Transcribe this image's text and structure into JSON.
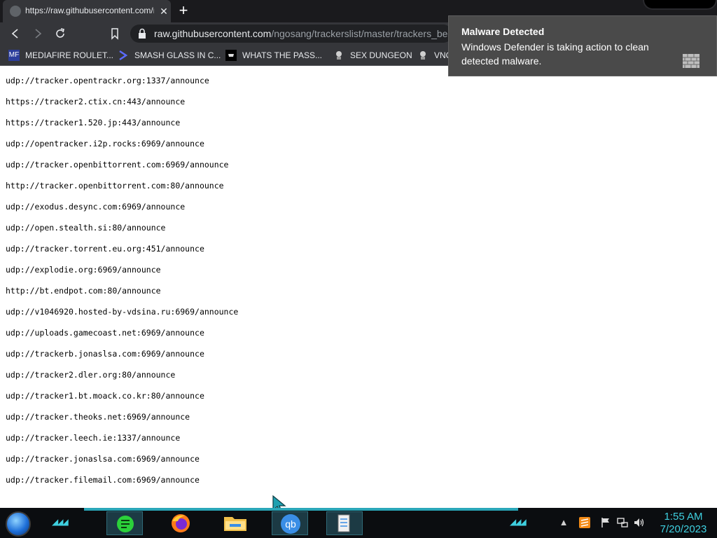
{
  "browser": {
    "tab": {
      "title": "https://raw.githubusercontent.com/ngosang/trackerslist/master/trackers_best.txt",
      "close_glyph": "✕"
    },
    "new_tab_glyph": "+",
    "url_host": "raw.githubusercontent.com",
    "url_path": "/ngosang/trackerslist/master/trackers_best.txt"
  },
  "bookmarks": [
    {
      "label": "MEDIAFIRE ROULET...",
      "icon": "MF"
    },
    {
      "label": "SMASH GLASS IN C...",
      "icon": "chevron"
    },
    {
      "label": "WHATS THE PASS...",
      "icon": "mask"
    },
    {
      "label": "SEX DUNGEON",
      "icon": "game"
    },
    {
      "label": "VNC",
      "icon": "game"
    }
  ],
  "trackers": [
    "udp://tracker.opentrackr.org:1337/announce",
    "https://tracker2.ctix.cn:443/announce",
    "https://tracker1.520.jp:443/announce",
    "udp://opentracker.i2p.rocks:6969/announce",
    "udp://tracker.openbittorrent.com:6969/announce",
    "http://tracker.openbittorrent.com:80/announce",
    "udp://exodus.desync.com:6969/announce",
    "udp://open.stealth.si:80/announce",
    "udp://tracker.torrent.eu.org:451/announce",
    "udp://explodie.org:6969/announce",
    "http://bt.endpot.com:80/announce",
    "udp://v1046920.hosted-by-vdsina.ru:6969/announce",
    "udp://uploads.gamecoast.net:6969/announce",
    "udp://trackerb.jonaslsa.com:6969/announce",
    "udp://tracker2.dler.org:80/announce",
    "udp://tracker1.bt.moack.co.kr:80/announce",
    "udp://tracker.theoks.net:6969/announce",
    "udp://tracker.leech.ie:1337/announce",
    "udp://tracker.jonaslsa.com:6969/announce",
    "udp://tracker.filemail.com:6969/announce"
  ],
  "notification": {
    "title": "Malware Detected",
    "body": "Windows Defender is taking action to clean detected malware."
  },
  "taskbar": {
    "time": "1:55 AM",
    "date": "7/20/2023",
    "accent_color": "#3fd0e0",
    "apps": [
      "notes-app-icon",
      "firefox-icon",
      "file-explorer-icon",
      "qbittorrent-icon",
      "task-manager-icon"
    ],
    "qbittorrent_label": "qb"
  }
}
